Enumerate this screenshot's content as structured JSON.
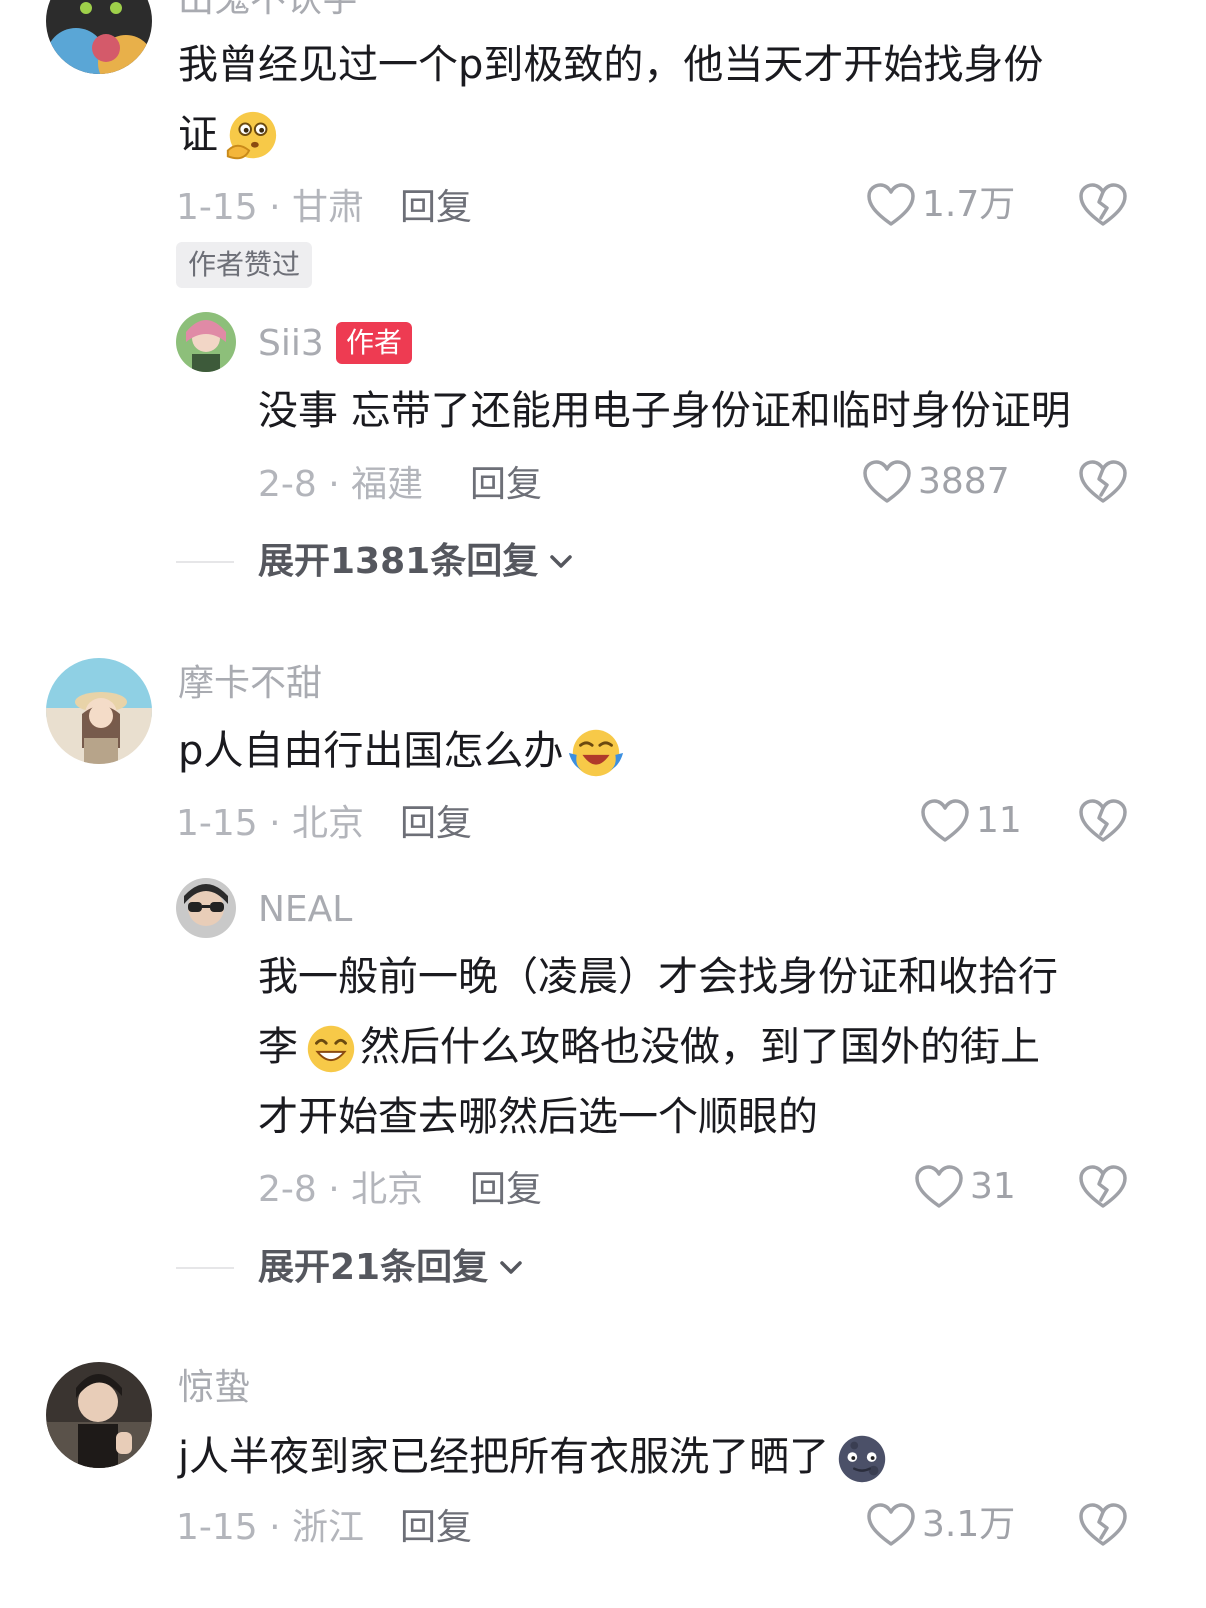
{
  "comments": [
    {
      "username": "出鬼不认字",
      "text_lines": [
        "我曾经见过一个p到极致的，他当天才开始找身份",
        "证"
      ],
      "emoji_icon": "thinking-face-icon",
      "date_location": "1-15 · 甘肃",
      "reply_label": "回复",
      "likes": "1.7万",
      "badge": "作者赞过",
      "reply": {
        "username": "Sii3",
        "tag": "作者",
        "text_lines": [
          "没事 忘带了还能用电子身份证和临时身份证明"
        ],
        "date_location": "2-8 · 福建",
        "reply_label": "回复",
        "likes": "3887"
      },
      "expand_label": "展开1381条回复"
    },
    {
      "username": "摩卡不甜",
      "text_lines": [
        "p人自由行出国怎么办"
      ],
      "emoji_icon": "crying-laughing-icon",
      "date_location": "1-15 · 北京",
      "reply_label": "回复",
      "likes": "11",
      "reply": {
        "username": "NEAL",
        "text_lines": [
          "我一般前一晚（凌晨）才会找身份证和收拾行",
          "李",
          "然后什么攻略也没做，到了国外的街上",
          "才开始查去哪然后选一个顺眼的"
        ],
        "emoji_icon": "grinning-face-icon",
        "date_location": "2-8 · 北京",
        "reply_label": "回复",
        "likes": "31"
      },
      "expand_label": "展开21条回复"
    },
    {
      "username": "惊蛰",
      "text_lines": [
        "j人半夜到家已经把所有衣服洗了晒了"
      ],
      "emoji_icon": "dark-moon-face-icon",
      "date_location": "1-15 · 浙江",
      "reply_label": "回复",
      "likes": "3.1万"
    }
  ],
  "colors": {
    "author_tag": "#ee3b52",
    "muted_text": "#b3b5bb",
    "primary_text": "#1a1a1f"
  }
}
